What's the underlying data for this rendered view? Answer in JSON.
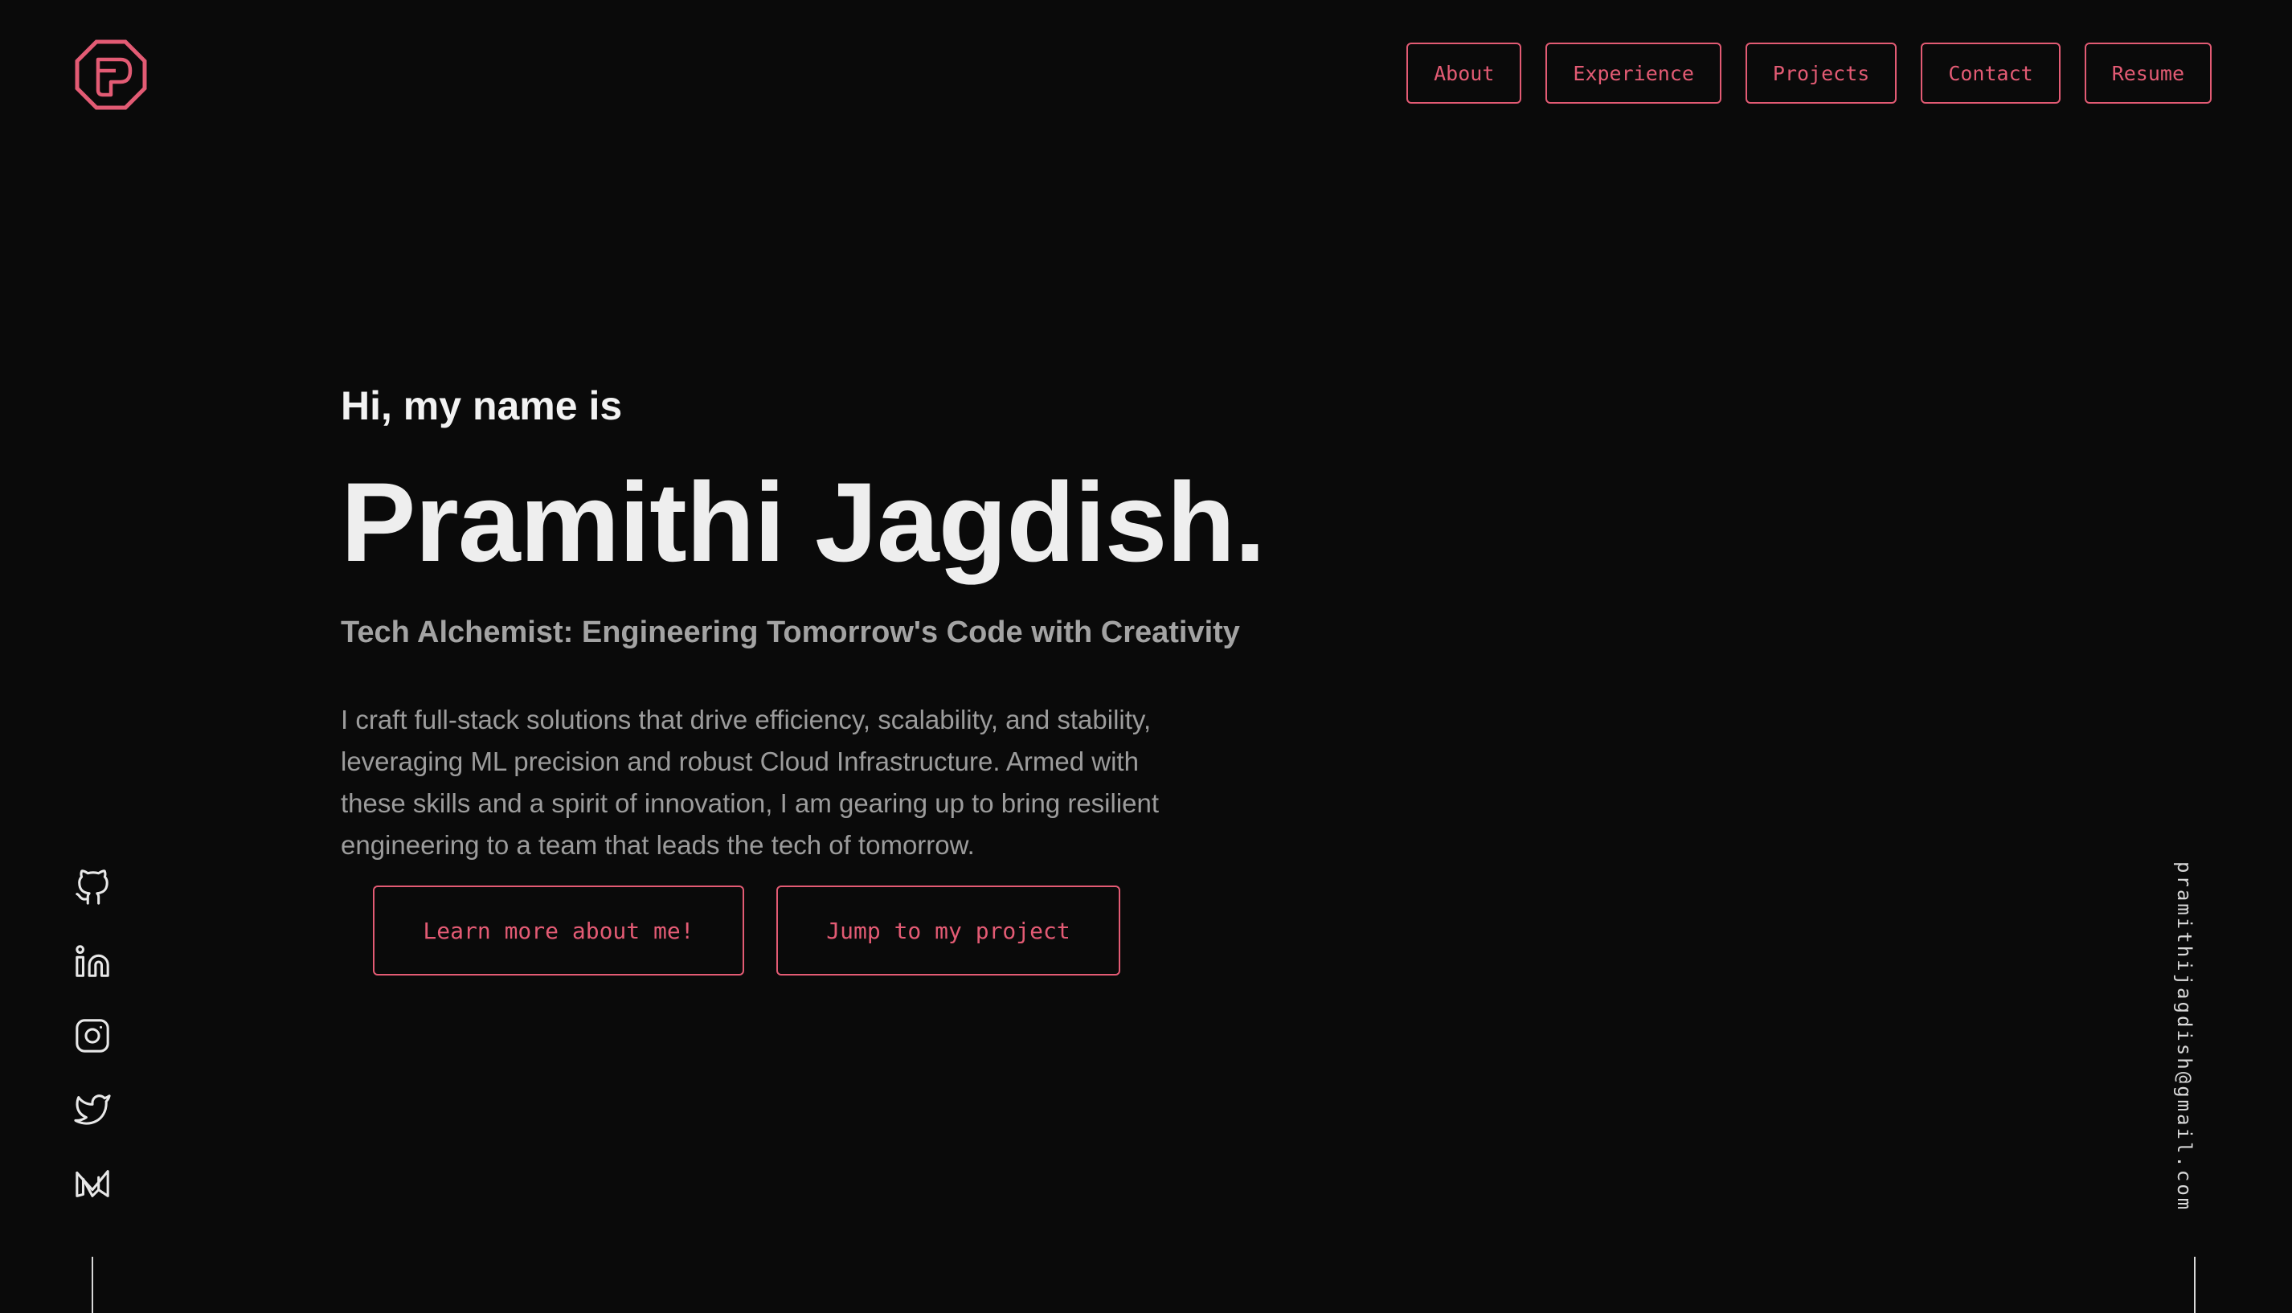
{
  "brand": {
    "logo_letter": "P",
    "accent_color": "#e35b74",
    "background_color": "#0a0a0a"
  },
  "nav": {
    "items": [
      "About",
      "Experience",
      "Projects",
      "Contact",
      "Resume"
    ]
  },
  "hero": {
    "greeting": "Hi, my name is",
    "name": "Pramithi Jagdish.",
    "tagline": "Tech Alchemist: Engineering Tomorrow's Code with Creativity",
    "intro": "I craft full-stack solutions that drive efficiency, scalability, and stability, leveraging ML precision and robust Cloud Infrastructure. Armed with these skills and a spirit of innovation, I am gearing up to bring resilient engineering to a team that leads the tech of tomorrow.",
    "cta_primary": "Learn more about me!",
    "cta_secondary": "Jump to my project"
  },
  "socials": {
    "icons": [
      "github-icon",
      "linkedin-icon",
      "instagram-icon",
      "twitter-icon",
      "medium-icon"
    ]
  },
  "contact": {
    "email": "pramithijagdish@gmail.com"
  }
}
